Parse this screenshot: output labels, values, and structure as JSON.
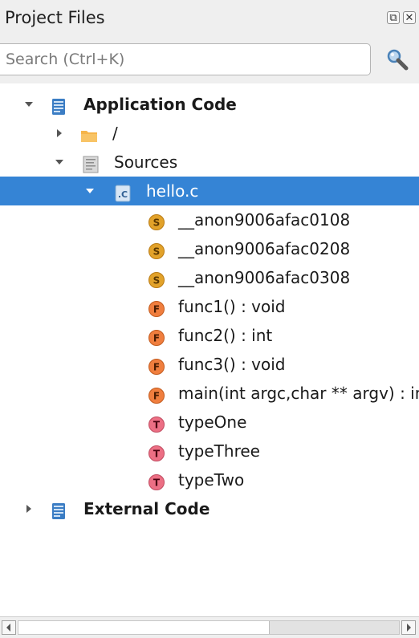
{
  "panel": {
    "title": "Project Files",
    "float_button": "⧉",
    "close_button": "✕"
  },
  "search": {
    "placeholder": "Search (Ctrl+K)",
    "value": ""
  },
  "tree": {
    "application_code": {
      "label": "Application Code",
      "expanded": true
    },
    "root_folder": {
      "label": "/",
      "expanded": false
    },
    "sources": {
      "label": "Sources",
      "expanded": true
    },
    "file": {
      "label": "hello.c",
      "badge": ".C",
      "selected": true,
      "expanded": true
    },
    "symbols": [
      {
        "kind": "S",
        "label": "__anon9006afac0108"
      },
      {
        "kind": "S",
        "label": "__anon9006afac0208"
      },
      {
        "kind": "S",
        "label": "__anon9006afac0308"
      },
      {
        "kind": "F",
        "label": "func1() : void"
      },
      {
        "kind": "F",
        "label": "func2() : int"
      },
      {
        "kind": "F",
        "label": "func3() : void"
      },
      {
        "kind": "F",
        "label": "main(int argc,char ** argv) : int"
      },
      {
        "kind": "T",
        "label": "typeOne"
      },
      {
        "kind": "T",
        "label": "typeThree"
      },
      {
        "kind": "T",
        "label": "typeTwo"
      }
    ],
    "external_code": {
      "label": "External Code",
      "expanded": false
    }
  },
  "colors": {
    "selection": "#3584d5",
    "struct_icon": "#e2a22a",
    "function_icon": "#f07e3e",
    "type_icon": "#ec6f84",
    "code_icon": "#3b7dc4",
    "folder_icon": "#f6b54a"
  }
}
